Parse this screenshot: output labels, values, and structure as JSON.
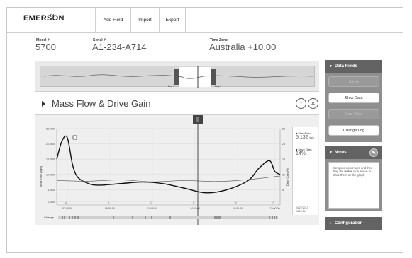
{
  "header": {
    "logo": "EMERSON",
    "logo_mark": "™",
    "nav": [
      {
        "label": "Add Field"
      },
      {
        "label": "Import"
      },
      {
        "label": "Export"
      }
    ]
  },
  "device": {
    "model_label": "Model #",
    "model_value": "5700",
    "serial_label": "Serial #",
    "serial_value": "A1-234-A714",
    "timezone_label": "Time Zone",
    "timezone_value": "Australia +10.00"
  },
  "overview": {
    "day_labels": [
      "Day 2",
      "Day 3"
    ]
  },
  "chart_panel": {
    "title": "Mass Flow & Drive Gain",
    "upload_icon": "upload-icon",
    "close_icon": "close-icon"
  },
  "chart_data": {
    "type": "line",
    "y_left_label": "Mass Flow (kg/h)",
    "y_right_label": "Drive Gain (%)",
    "y_left_ticks": [
      "25.0000",
      "20.0000",
      "15.0000",
      "10.0000",
      "5.0000",
      "1.0000"
    ],
    "y_right_ticks": [
      "25",
      "20",
      "15",
      "10",
      "5"
    ],
    "x_ticks": [
      "02:00:00",
      "06:00:00",
      "10:00:00",
      "14:00:00",
      "18:00:00",
      "22:00:00"
    ],
    "x_tick_ids": [
      "A",
      "B",
      "C",
      "D",
      "E",
      "F"
    ],
    "ylim": [
      0,
      25
    ],
    "series": [
      {
        "name": "MassFlow",
        "color": "#111111",
        "x": [
          0.0,
          0.5,
          1.0,
          1.5,
          2.0,
          3.0,
          4.0,
          6.0,
          8.0,
          10.0,
          12.0,
          14.0,
          16.0,
          18.0,
          19.0,
          20.0,
          20.5,
          21.0
        ],
        "y": [
          15.0,
          21.0,
          22.0,
          13.0,
          9.0,
          7.0,
          6.5,
          7.0,
          7.5,
          7.0,
          5.5,
          4.0,
          5.0,
          8.0,
          12.0,
          14.5,
          11.0,
          10.0
        ]
      },
      {
        "name": "Drive Gain",
        "color": "#555555",
        "x": [
          0.0,
          3.0,
          6.0,
          9.0,
          12.0,
          15.0,
          18.0,
          21.0
        ],
        "y": [
          8.0,
          7.8,
          8.2,
          7.6,
          8.0,
          7.7,
          8.3,
          9.5
        ]
      }
    ]
  },
  "legend": {
    "items": [
      {
        "name": "MassFlow",
        "value": "5.132",
        "unit": "kg/s"
      },
      {
        "name": "Drive Gain",
        "value": "14%",
        "unit": ""
      }
    ],
    "date": "04/27/2013",
    "time": "15:29:14"
  },
  "change_bar": {
    "label": "Change"
  },
  "sidebar": {
    "data_fields": {
      "header": "Data Fields",
      "buttons": [
        {
          "label": "Alerts",
          "state": "disabled"
        },
        {
          "label": "Slow Data",
          "state": "enabled"
        },
        {
          "label": "Fast Data",
          "state": "disabled"
        },
        {
          "label": "Change Log",
          "state": "enabled"
        }
      ]
    },
    "notes": {
      "header": "Notes",
      "text_pre": "Compose notes here and then drag the",
      "text_bold": "Notes",
      "text_post": "icon above to place them on the graph."
    },
    "configuration": {
      "header": "Configuration"
    }
  }
}
